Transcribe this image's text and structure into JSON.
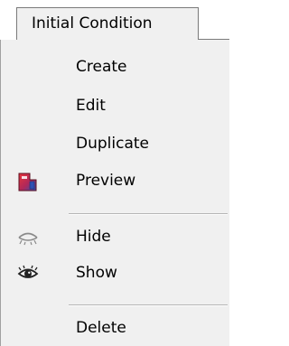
{
  "tab": {
    "label": "Initial Condition"
  },
  "menu": {
    "items": [
      {
        "label": "Create",
        "icon": ""
      },
      {
        "label": "Edit",
        "icon": ""
      },
      {
        "label": "Duplicate",
        "icon": ""
      },
      {
        "label": "Preview",
        "icon": "preview-icon"
      },
      {
        "label": "Hide",
        "icon": "eye-closed-icon"
      },
      {
        "label": "Show",
        "icon": "eye-open-icon"
      },
      {
        "label": "Delete",
        "icon": ""
      }
    ]
  },
  "colors": {
    "menu_background": "#f0f0f0",
    "separator": "#b5b5b5",
    "preview_icon_red": "#d8232a",
    "preview_icon_blue": "#2f4fb3"
  }
}
